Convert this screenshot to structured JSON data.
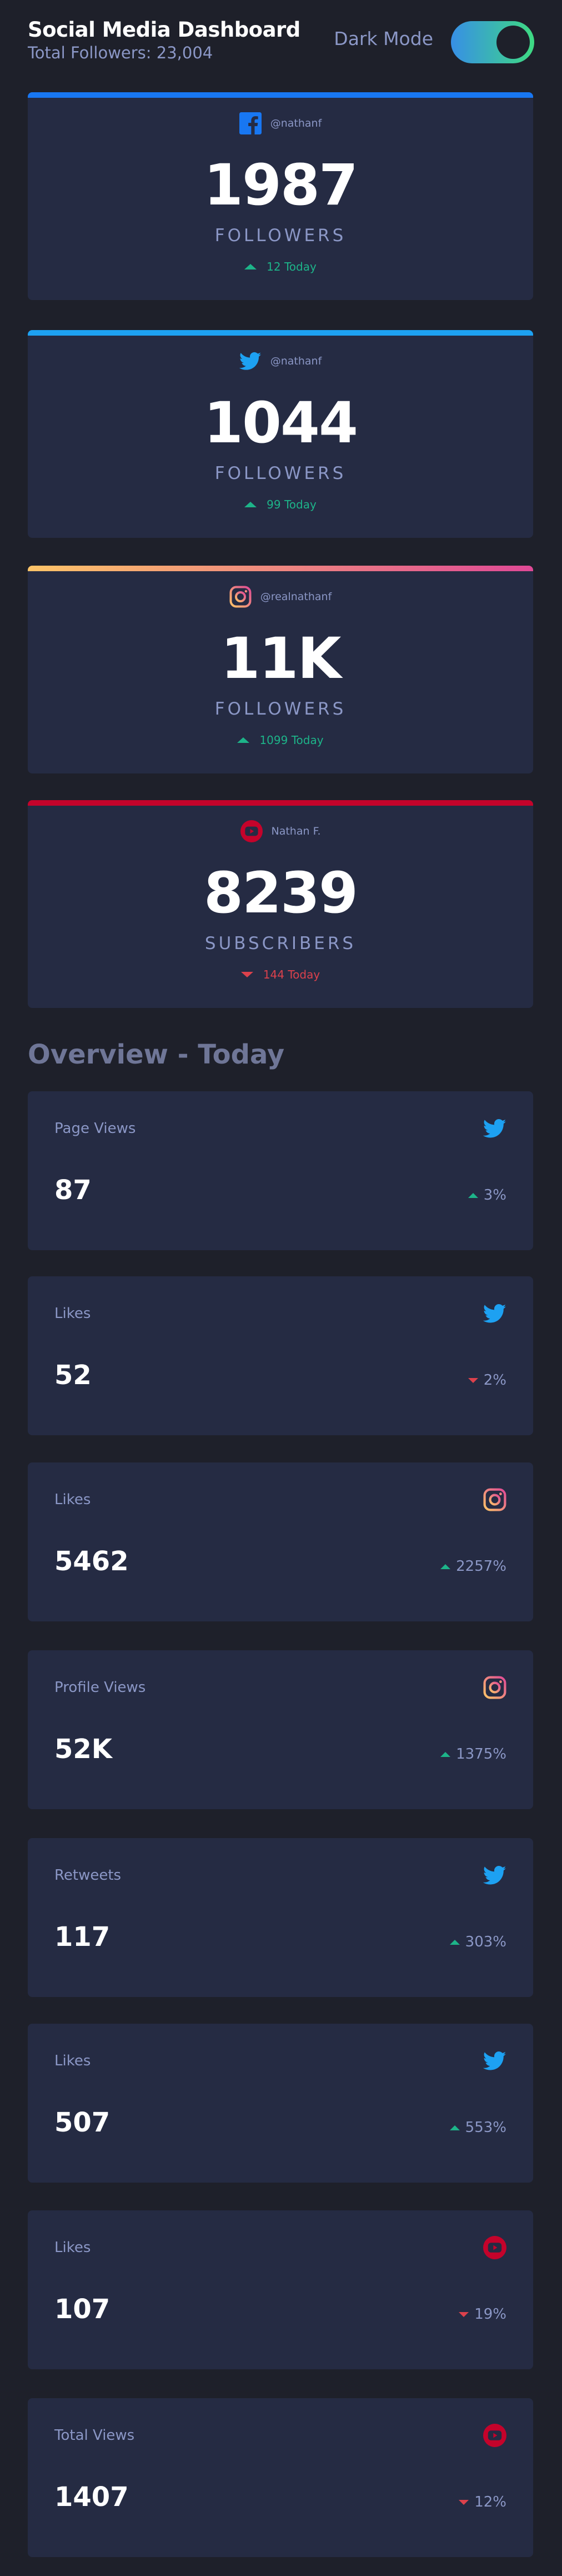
{
  "header": {
    "title": "Social Media Dashboard",
    "subtitle": "Total Followers: 23,004",
    "toggle_label": "Dark Mode"
  },
  "colors": {
    "facebook": "#1877f2",
    "twitter": "#1da1f2",
    "instagram_start": "#fdc468",
    "instagram_end": "#df4996",
    "youtube": "#c4032b",
    "up": "#1db489",
    "down": "#dc414c"
  },
  "follower_cards": [
    {
      "platform": "facebook",
      "icon": "facebook-icon",
      "handle": "@nathanf",
      "count": "1987",
      "label": "FOLLOWERS",
      "change": "12 Today",
      "direction": "up"
    },
    {
      "platform": "twitter",
      "icon": "twitter-icon",
      "handle": "@nathanf",
      "count": "1044",
      "label": "FOLLOWERS",
      "change": "99 Today",
      "direction": "up"
    },
    {
      "platform": "instagram",
      "icon": "instagram-icon",
      "handle": "@realnathanf",
      "count": "11K",
      "label": "FOLLOWERS",
      "change": "1099 Today",
      "direction": "up"
    },
    {
      "platform": "youtube",
      "icon": "youtube-icon",
      "handle": "Nathan F.",
      "count": "8239",
      "label": "SUBSCRIBERS",
      "change": "144 Today",
      "direction": "down"
    }
  ],
  "overview": {
    "title": "Overview - Today",
    "cards": [
      {
        "label": "Page Views",
        "platform": "twitter",
        "icon": "twitter-icon",
        "value": "87",
        "change": "3%",
        "direction": "up"
      },
      {
        "label": "Likes",
        "platform": "twitter",
        "icon": "twitter-icon",
        "value": "52",
        "change": "2%",
        "direction": "down"
      },
      {
        "label": "Likes",
        "platform": "instagram",
        "icon": "instagram-icon",
        "value": "5462",
        "change": "2257%",
        "direction": "up"
      },
      {
        "label": "Profile Views",
        "platform": "instagram",
        "icon": "instagram-icon",
        "value": "52K",
        "change": "1375%",
        "direction": "up"
      },
      {
        "label": "Retweets",
        "platform": "twitter",
        "icon": "twitter-icon",
        "value": "117",
        "change": "303%",
        "direction": "up"
      },
      {
        "label": "Likes",
        "platform": "twitter",
        "icon": "twitter-icon",
        "value": "507",
        "change": "553%",
        "direction": "up"
      },
      {
        "label": "Likes",
        "platform": "youtube",
        "icon": "youtube-icon",
        "value": "107",
        "change": "19%",
        "direction": "down"
      },
      {
        "label": "Total Views",
        "platform": "youtube",
        "icon": "youtube-icon",
        "value": "1407",
        "change": "12%",
        "direction": "down"
      }
    ]
  }
}
